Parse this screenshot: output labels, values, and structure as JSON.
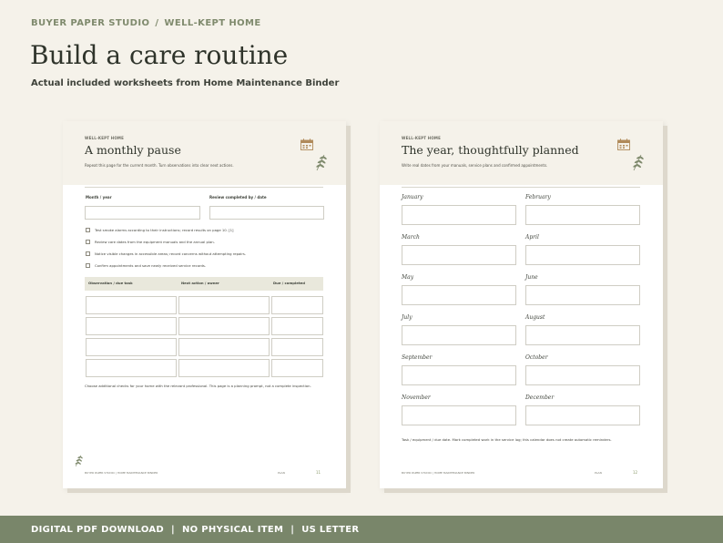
{
  "header": {
    "breadcrumb": [
      "BUYER PAPER STUDIO",
      "WELL-KEPT HOME"
    ],
    "breadcrumb_sep": "/",
    "title": "Build a care routine",
    "subtitle": "Actual included worksheets from Home Maintenance Binder"
  },
  "left_sheet": {
    "brand": "WELL-KEPT HOME",
    "title": "A monthly pause",
    "description": "Repeat this page for the current month. Turn observations into clear next actions.",
    "fields": [
      "Month / year",
      "Review completed by / date"
    ],
    "checklist": [
      "Test smoke alarms according to their instructions; record results on page 10. [1]",
      "Review care dates from the equipment manuals and the annual plan.",
      "Notice visible changes in accessible areas; record concerns without attempting repairs.",
      "Confirm appointments and save newly received service records."
    ],
    "table_headers": [
      "Observation / due task",
      "Next action / owner",
      "Due / completed"
    ],
    "note": "Choose additional checks for your home with the relevant professional. This page is a planning prompt, not a complete inspection.",
    "footer_left": "BUYER PAPER STUDIO  |  HOME MAINTENANCE BINDER",
    "footer_plan": "PLAN",
    "page_number": "11"
  },
  "right_sheet": {
    "brand": "WELL-KEPT HOME",
    "title": "The year, thoughtfully planned",
    "description": "Write real dates from your manuals, service plans and confirmed appointments.",
    "months": [
      "January",
      "February",
      "March",
      "April",
      "May",
      "June",
      "July",
      "August",
      "September",
      "October",
      "November",
      "December"
    ],
    "note": "Task / equipment / due date. Mark completed work in the service log; this calendar does not create automatic reminders.",
    "footer_left": "BUYER PAPER STUDIO  |  HOME MAINTENANCE BINDER",
    "footer_plan": "PLAN",
    "page_number": "12"
  },
  "footer": {
    "items": [
      "DIGITAL PDF DOWNLOAD",
      "NO PHYSICAL ITEM",
      "US LETTER"
    ],
    "sep": "|"
  },
  "colors": {
    "background": "#f5f2ea",
    "accent_green": "#79866a",
    "breadcrumb_green": "#7f8a6d",
    "calendar_brown": "#b08a5a"
  }
}
